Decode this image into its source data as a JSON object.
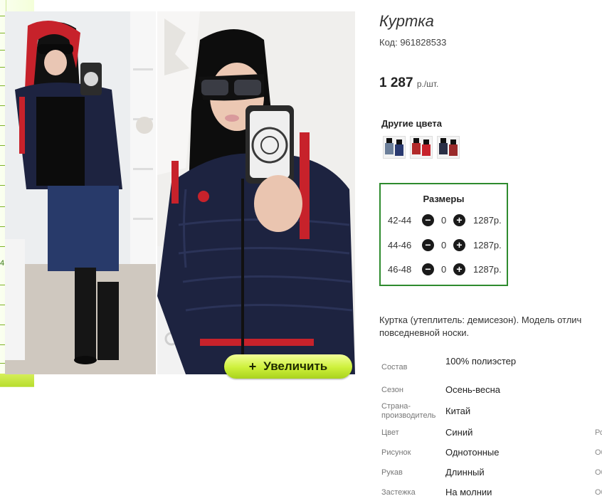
{
  "product": {
    "title": "Куртка",
    "code": "Код: 961828533",
    "price": "1 287",
    "price_unit": "р./шт.",
    "other_colors_label": "Другие цвета",
    "swatches": [
      {
        "name": "swatch-1",
        "color": "#6c7f9a"
      },
      {
        "name": "swatch-2",
        "color": "#b22a2a"
      },
      {
        "name": "swatch-3",
        "color": "#2a2f45"
      }
    ]
  },
  "gallery": {
    "zoom_icon": "+",
    "zoom_label": "Увеличить"
  },
  "sizes": {
    "title": "Размеры",
    "rows": [
      {
        "size": "42-44",
        "minus": "−",
        "qty": "0",
        "plus": "+",
        "price": "1287р."
      },
      {
        "size": "44-46",
        "minus": "−",
        "qty": "0",
        "plus": "+",
        "price": "1287р."
      },
      {
        "size": "46-48",
        "minus": "−",
        "qty": "0",
        "plus": "+",
        "price": "1287р."
      }
    ]
  },
  "description": "Куртка (утеплитель: демисезон). Модель отлич повседневной носки.",
  "properties": [
    {
      "label": "Состав",
      "value": "100% полиэстер",
      "extra": ""
    },
    {
      "label": "Сезон",
      "value": "Осень-весна",
      "extra": ""
    },
    {
      "label": "Страна-производитель",
      "value": "Китай",
      "extra": ""
    },
    {
      "label": "Цвет",
      "value": "Синий",
      "extra": "Ро"
    },
    {
      "label": "Рисунок",
      "value": "Однотонные",
      "extra": "Об"
    },
    {
      "label": "Рукав",
      "value": "Длинный",
      "extra": "Об"
    },
    {
      "label": "Застежка",
      "value": "На молнии",
      "extra": "Об"
    }
  ],
  "side": {
    "number": "4"
  },
  "colors": {
    "accent_green": "#2e8b2e",
    "zoom_button": "#cdf03a",
    "jacket_navy": "#1d2340",
    "jacket_red": "#c7222b"
  }
}
